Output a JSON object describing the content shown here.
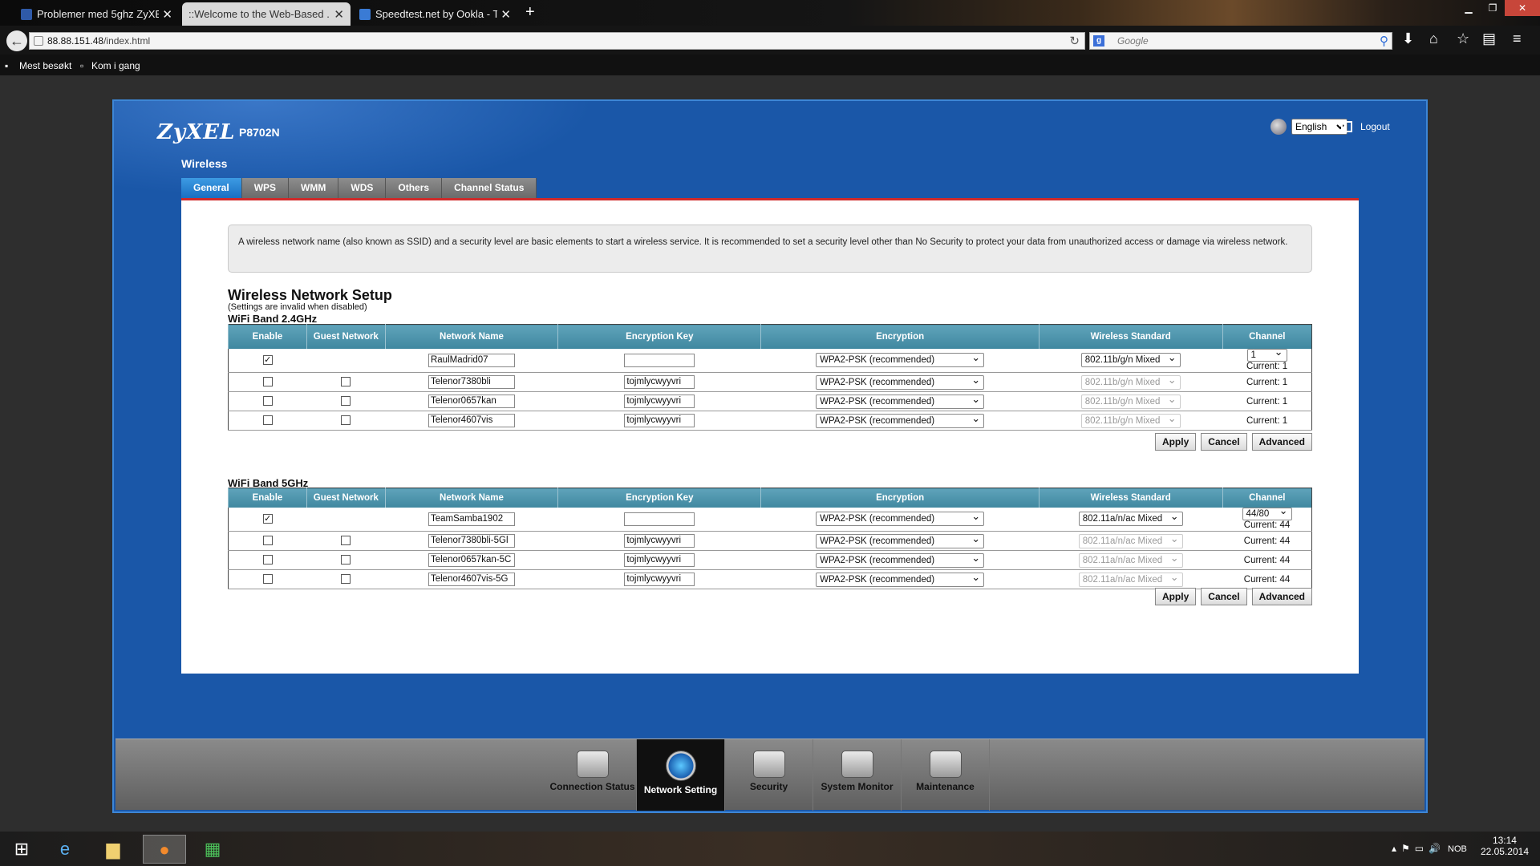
{
  "browser": {
    "tabs": [
      {
        "title": "Problemer med 5ghz ZyXE...",
        "active": false,
        "favicon_color": "#2f5aa8"
      },
      {
        "title": "::Welcome to the Web-Based ...",
        "active": true,
        "favicon_color": "#888888"
      },
      {
        "title": "Speedtest.net by Ookla - T...",
        "active": false,
        "favicon_color": "#3a7bd5"
      }
    ],
    "new_tab": "+",
    "url_host": "88.88.151.48",
    "url_path": "/index.html",
    "search_engine": "g",
    "search_placeholder": "Google",
    "bookmarks": [
      "Mest besøkt",
      "Kom i gang"
    ]
  },
  "router": {
    "brand": "ZyXEL",
    "model": "P8702N",
    "language": "English",
    "logout": "Logout",
    "section": "Wireless",
    "subtabs": [
      "General",
      "WPS",
      "WMM",
      "WDS",
      "Others",
      "Channel Status"
    ],
    "active_subtab": "General",
    "notice": "A wireless network name (also known as SSID) and a security level are basic elements to start a wireless service. It is recommended to set a security level other than No Security to protect your data from unauthorized access or damage via wireless network.",
    "setup_title": "Wireless Network Setup",
    "setup_subtitle": "(Settings are invalid when disabled)",
    "band24": {
      "title": "WiFi Band 2.4GHz",
      "headers": [
        "Enable",
        "Guest Network",
        "Network Name",
        "Encryption Key",
        "Encryption",
        "Wireless Standard",
        "Channel"
      ],
      "main_row": {
        "enabled": true,
        "name": "RaulMadrid07",
        "key": "",
        "encryption": "WPA2-PSK (recommended)",
        "standard": "802.11b/g/n Mixed",
        "channel": "1",
        "current": "Current: 1"
      },
      "guest_rows": [
        {
          "enabled": false,
          "guest": false,
          "name": "Telenor7380bli",
          "key": "tojmlycwyyvri",
          "encryption": "WPA2-PSK (recommended)",
          "standard": "802.11b/g/n Mixed",
          "current": "Current: 1"
        },
        {
          "enabled": false,
          "guest": false,
          "name": "Telenor0657kan",
          "key": "tojmlycwyyvri",
          "encryption": "WPA2-PSK (recommended)",
          "standard": "802.11b/g/n Mixed",
          "current": "Current: 1"
        },
        {
          "enabled": false,
          "guest": false,
          "name": "Telenor4607vis",
          "key": "tojmlycwyyvri",
          "encryption": "WPA2-PSK (recommended)",
          "standard": "802.11b/g/n Mixed",
          "current": "Current: 1"
        }
      ]
    },
    "band5": {
      "title": "WiFi Band 5GHz",
      "headers": [
        "Enable",
        "Guest Network",
        "Network Name",
        "Encryption Key",
        "Encryption",
        "Wireless Standard",
        "Channel"
      ],
      "main_row": {
        "enabled": true,
        "name": "TeamSamba1902",
        "key": "",
        "encryption": "WPA2-PSK (recommended)",
        "standard": "802.11a/n/ac Mixed",
        "channel": "44/80",
        "current": "Current: 44"
      },
      "guest_rows": [
        {
          "enabled": false,
          "guest": false,
          "name": "Telenor7380bli-5Gl",
          "key": "tojmlycwyyvri",
          "encryption": "WPA2-PSK (recommended)",
          "standard": "802.11a/n/ac Mixed",
          "current": "Current: 44"
        },
        {
          "enabled": false,
          "guest": false,
          "name": "Telenor0657kan-5C",
          "key": "tojmlycwyyvri",
          "encryption": "WPA2-PSK (recommended)",
          "standard": "802.11a/n/ac Mixed",
          "current": "Current: 44"
        },
        {
          "enabled": false,
          "guest": false,
          "name": "Telenor4607vis-5G",
          "key": "tojmlycwyyvri",
          "encryption": "WPA2-PSK (recommended)",
          "standard": "802.11a/n/ac Mixed",
          "current": "Current: 44"
        }
      ]
    },
    "buttons": {
      "apply": "Apply",
      "cancel": "Cancel",
      "advanced": "Advanced"
    },
    "bottom_nav": [
      {
        "label": "Connection Status",
        "icon": "monitor-icon",
        "active": false
      },
      {
        "label": "Network Setting",
        "icon": "globe-gear-icon",
        "active": true
      },
      {
        "label": "Security",
        "icon": "shield-icon",
        "active": false
      },
      {
        "label": "System Monitor",
        "icon": "chart-icon",
        "active": false
      },
      {
        "label": "Maintenance",
        "icon": "toolbox-icon",
        "active": false
      }
    ]
  },
  "taskbar": {
    "apps": [
      "start-icon",
      "ie-icon",
      "explorer-icon",
      "firefox-icon",
      "store-icon"
    ],
    "lang": "NOB",
    "time": "13:14",
    "date": "22.05.2014"
  }
}
